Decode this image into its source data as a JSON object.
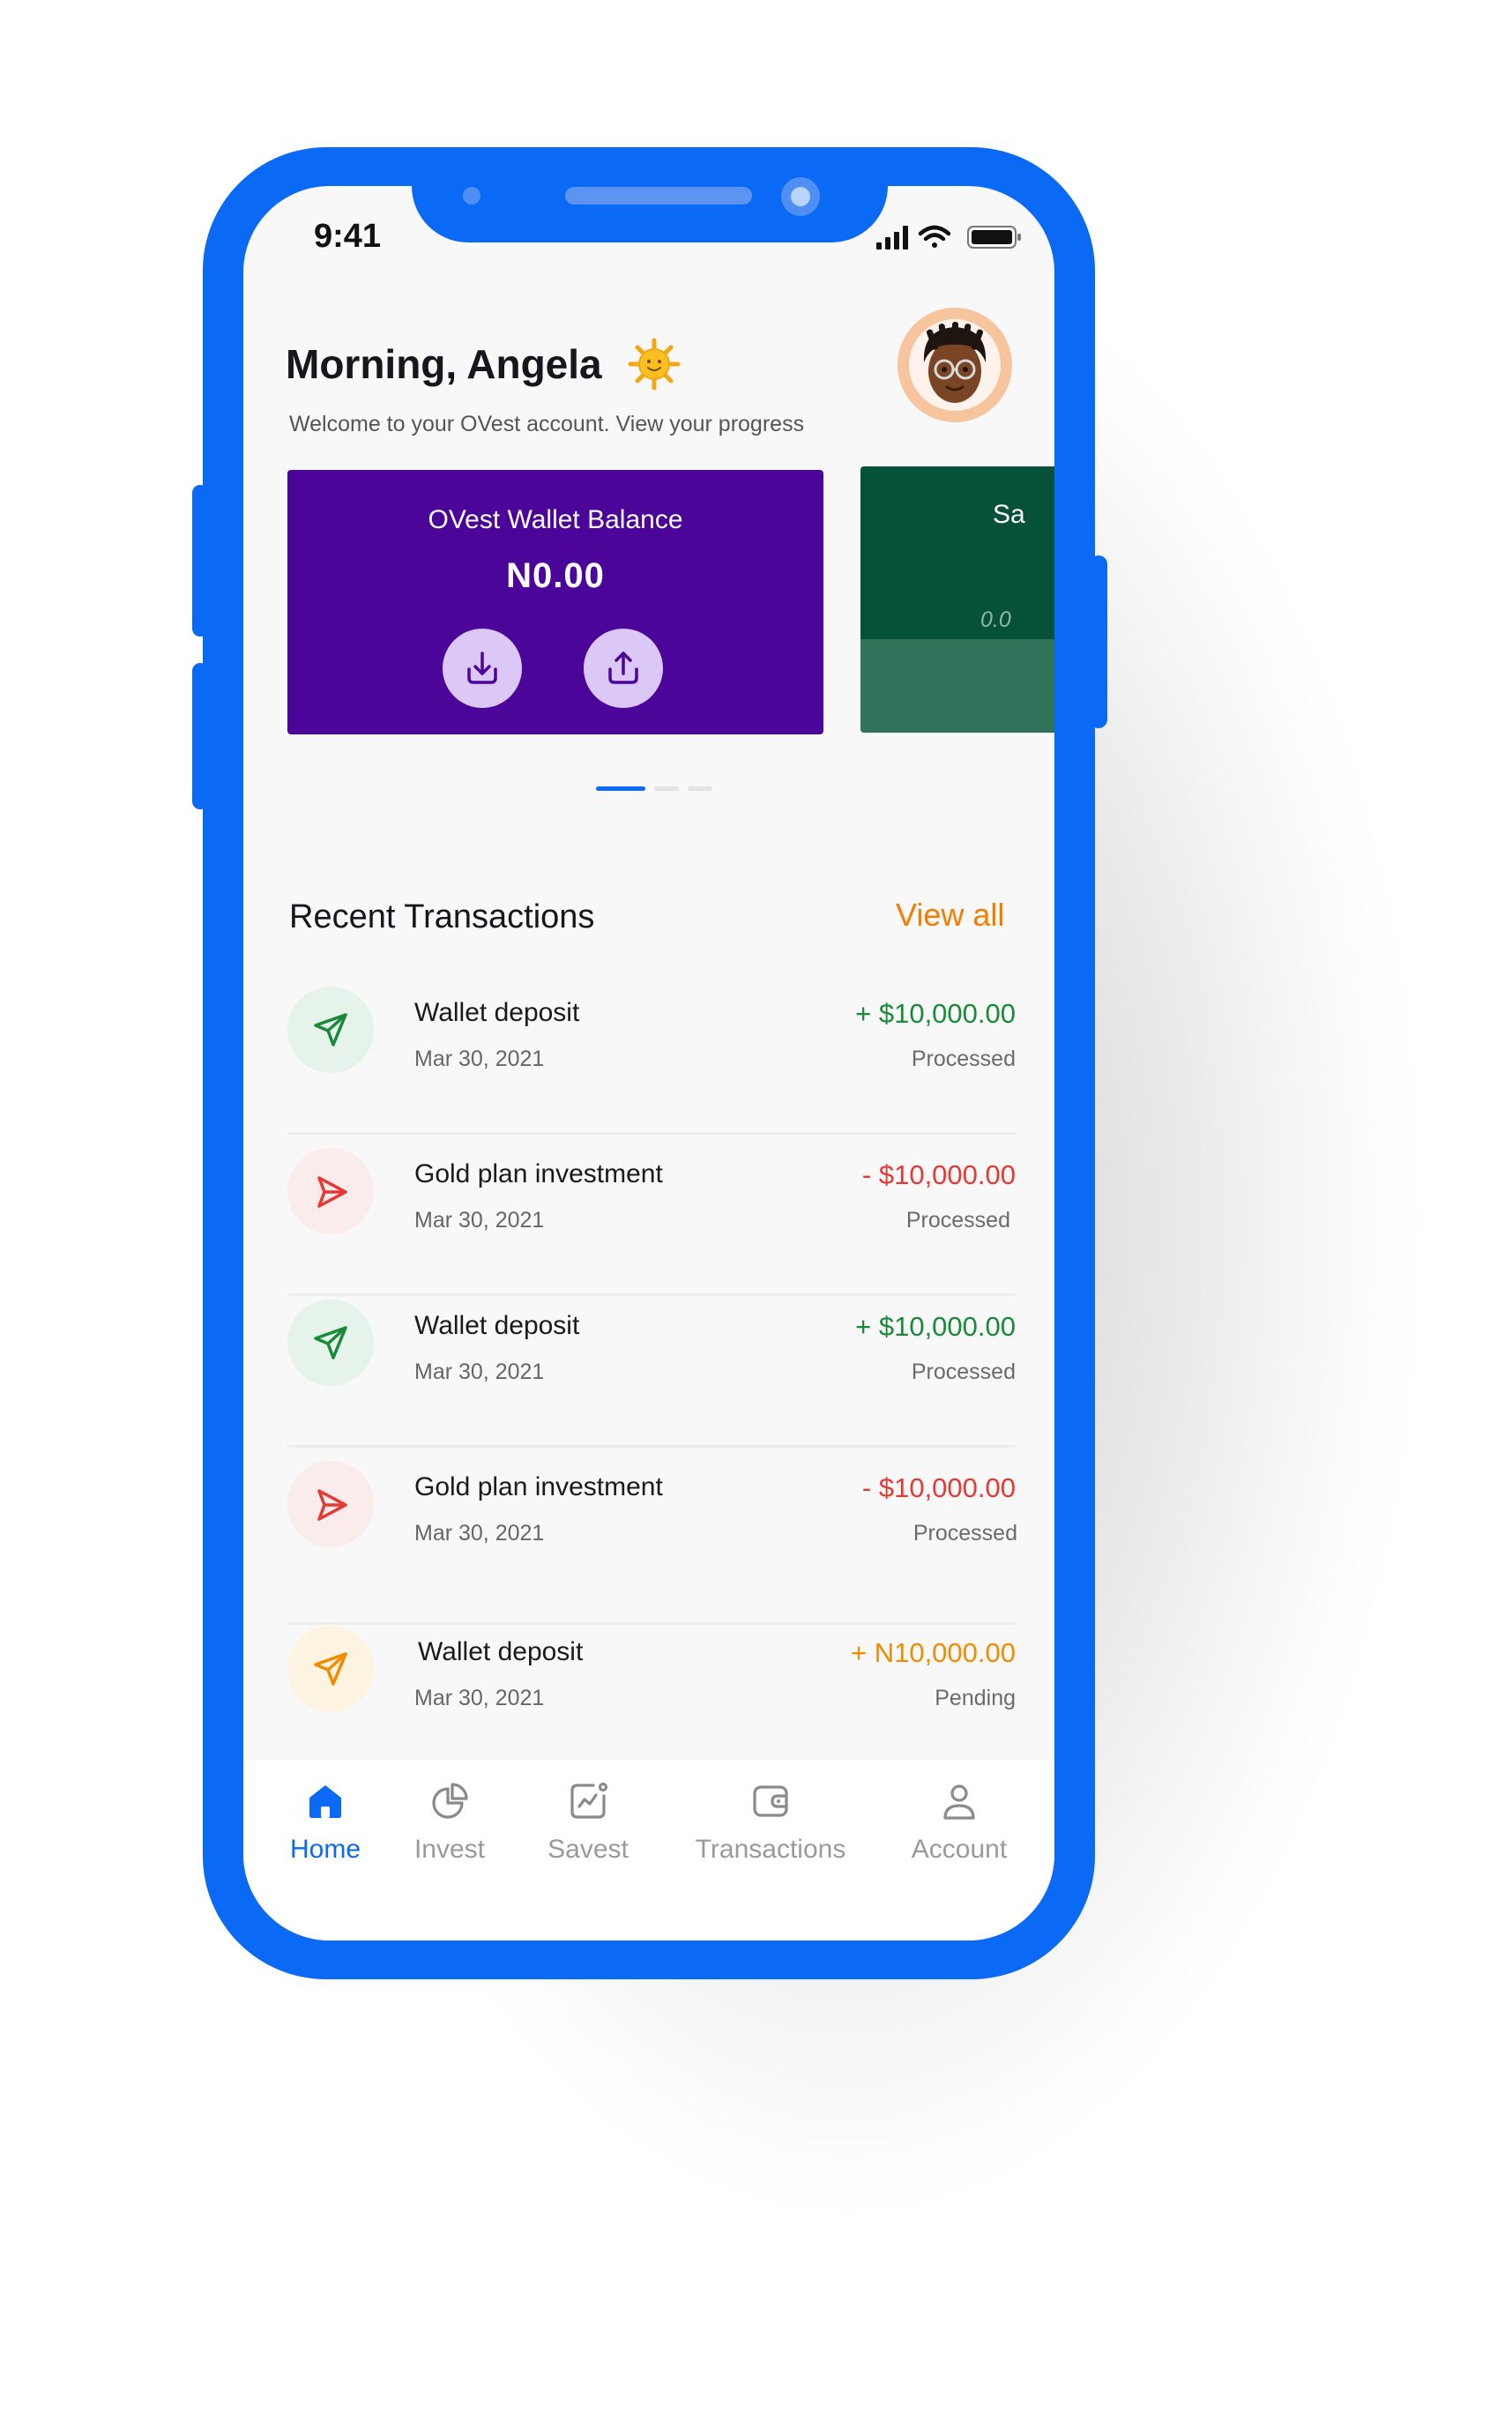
{
  "status_bar": {
    "time": "9:41"
  },
  "header": {
    "greeting": "Morning, Angela",
    "subtitle": "Welcome to your OVest account. View your progress"
  },
  "cards": {
    "wallet": {
      "title": "OVest Wallet Balance",
      "amount": "N0.00"
    },
    "savings": {
      "title_partial": "Sa",
      "amount_partial": "0.0"
    }
  },
  "recent": {
    "title": "Recent Transactions",
    "view_all": "View all",
    "items": [
      {
        "name": "Wallet deposit",
        "date": "Mar 30, 2021",
        "amount": "+ $10,000.00",
        "status": "Processed",
        "type": "deposit"
      },
      {
        "name": "Gold plan investment",
        "date": "Mar 30, 2021",
        "amount": "- $10,000.00",
        "status": "Processed",
        "type": "investment"
      },
      {
        "name": "Wallet deposit",
        "date": "Mar 30, 2021",
        "amount": "+ $10,000.00",
        "status": "Processed",
        "type": "deposit"
      },
      {
        "name": "Gold plan investment",
        "date": "Mar 30, 2021",
        "amount": "- $10,000.00",
        "status": "Processed",
        "type": "investment"
      },
      {
        "name": "Wallet deposit",
        "date": "Mar 30, 2021",
        "amount": "+ N10,000.00",
        "status": "Pending",
        "type": "pending"
      }
    ]
  },
  "nav": {
    "items": [
      {
        "label": "Home",
        "icon": "home-icon",
        "active": true
      },
      {
        "label": "Invest",
        "icon": "pie-chart-icon",
        "active": false
      },
      {
        "label": "Savest",
        "icon": "growth-chart-icon",
        "active": false
      },
      {
        "label": "Transactions",
        "icon": "wallet-icon",
        "active": false
      },
      {
        "label": "Account",
        "icon": "user-icon",
        "active": false
      }
    ]
  },
  "colors": {
    "frame": "#0a69f5",
    "wallet_card": "#4c0599",
    "savings_card": "#06513a",
    "accent": "#f57c00",
    "positive": "#1a8a3a",
    "negative": "#e53935",
    "pending": "#f08c00"
  }
}
